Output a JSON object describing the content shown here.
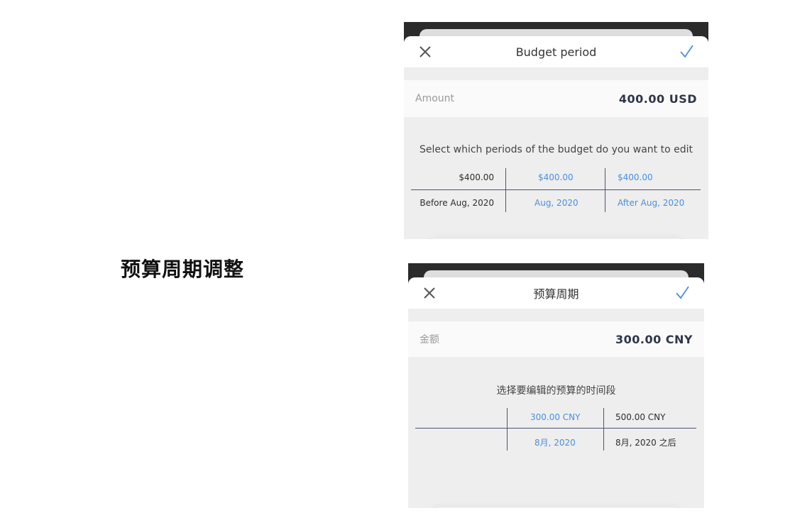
{
  "caption": "预算周期调整",
  "en": {
    "title": "Budget period",
    "amount_label": "Amount",
    "amount_value": "400.00  USD",
    "prompt": "Select which periods of the budget do you want to edit",
    "columns": [
      {
        "amount": "$400.00",
        "period": "Before Aug, 2020"
      },
      {
        "amount": "$400.00",
        "period": "Aug, 2020"
      },
      {
        "amount": "$400.00",
        "period": "After Aug, 2020"
      }
    ]
  },
  "zh": {
    "title": "预算周期",
    "amount_label": "金额",
    "amount_value": "300.00 CNY",
    "prompt": "选择要编辑的预算的时间段",
    "columns": [
      {
        "amount": "",
        "period": ""
      },
      {
        "amount": "300.00 CNY",
        "period": "8月, 2020"
      },
      {
        "amount": "500.00 CNY",
        "period": "8月, 2020 之后"
      }
    ]
  },
  "icons": {
    "close": "close-icon",
    "confirm": "check-icon"
  },
  "colors": {
    "accent": "#4a8fe0",
    "amount_text": "#2f3549",
    "line": "#4a5575"
  }
}
